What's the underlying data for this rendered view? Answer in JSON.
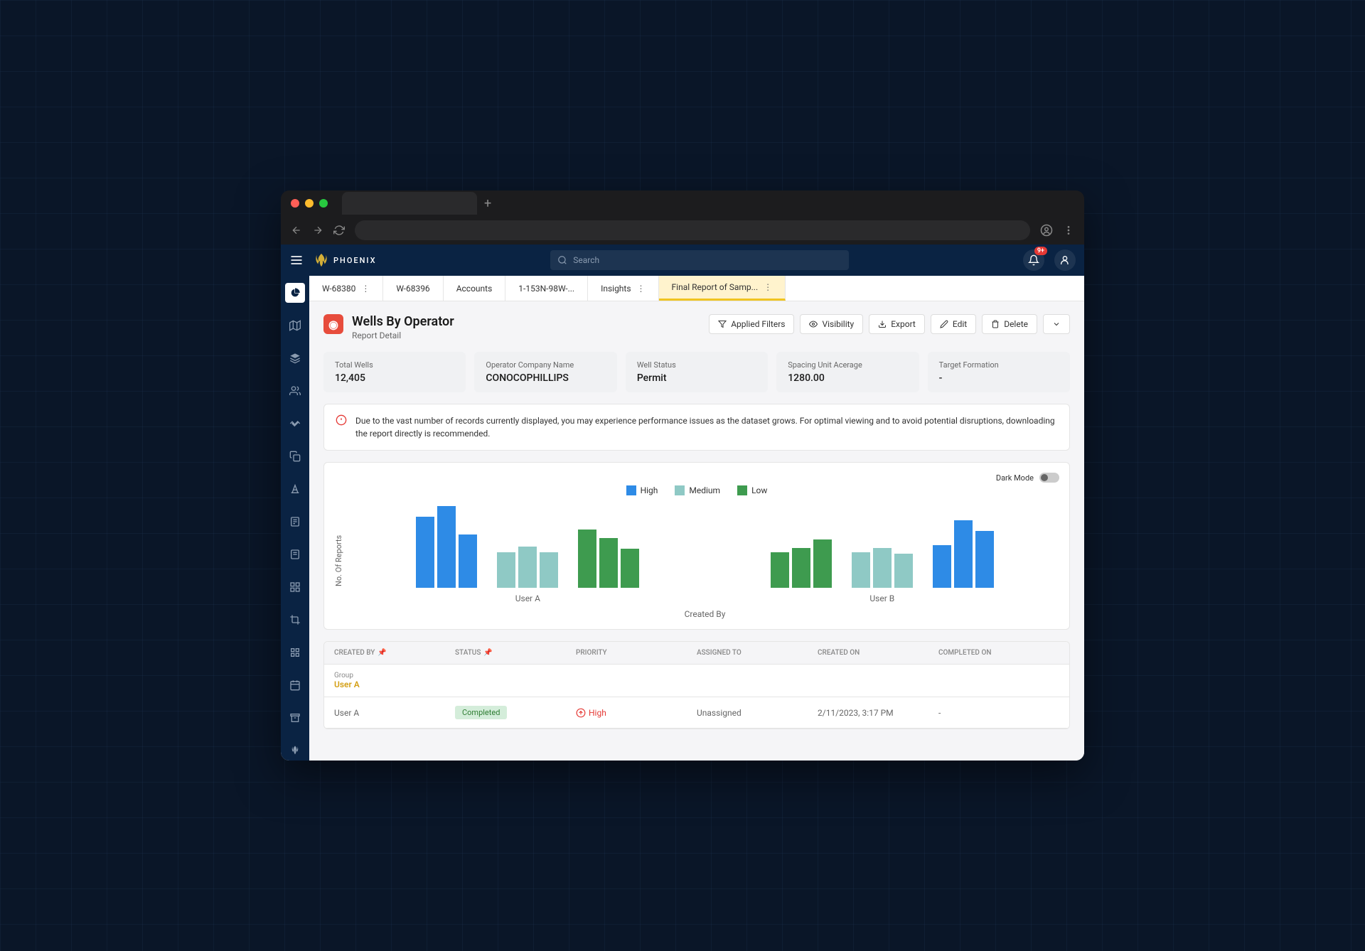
{
  "browser": {
    "new_tab": "+"
  },
  "app": {
    "name": "PHOENIX",
    "search_placeholder": "Search",
    "notif_badge": "9+"
  },
  "tabs": [
    {
      "label": "W-68380",
      "menu": true
    },
    {
      "label": "W-68396"
    },
    {
      "label": "Accounts"
    },
    {
      "label": "1-153N-98W-..."
    },
    {
      "label": "Insights",
      "menu": true
    },
    {
      "label": "Final Report of Samp...",
      "menu": true,
      "active": true
    }
  ],
  "title": {
    "heading": "Wells By Operator",
    "sub": "Report Detail"
  },
  "actions": {
    "filters": "Applied Filters",
    "visibility": "Visibility",
    "export": "Export",
    "edit": "Edit",
    "delete": "Delete"
  },
  "stats": [
    {
      "label": "Total Wells",
      "value": "12,405"
    },
    {
      "label": "Operator Company Name",
      "value": "CONOCOPHILLIPS"
    },
    {
      "label": "Well Status",
      "value": "Permit"
    },
    {
      "label": "Spacing Unit Acerage",
      "value": "1280.00"
    },
    {
      "label": "Target Formation",
      "value": "-"
    }
  ],
  "alert": "Due to the vast number of records currently displayed, you may experience performance issues as the dataset grows. For optimal viewing and to avoid potential disruptions,  downloading the report directly is recommended.",
  "dark_mode_label": "Dark Mode",
  "chart_data": {
    "type": "bar",
    "ylabel": "No. Of Reports",
    "xlabel": "Created By",
    "legend": [
      {
        "name": "High",
        "color": "#2e8be6"
      },
      {
        "name": "Medium",
        "color": "#8fc9c5"
      },
      {
        "name": "Low",
        "color": "#3e9b4f"
      }
    ],
    "groups": [
      {
        "name": "User A",
        "clusters": [
          {
            "values": [
              100,
              115,
              75
            ],
            "colors": [
              "#2e8be6",
              "#2e8be6",
              "#2e8be6"
            ]
          },
          {
            "values": [
              50,
              58,
              50
            ],
            "colors": [
              "#8fc9c5",
              "#8fc9c5",
              "#8fc9c5"
            ]
          },
          {
            "values": [
              82,
              70,
              55
            ],
            "colors": [
              "#3e9b4f",
              "#3e9b4f",
              "#3e9b4f"
            ]
          }
        ]
      },
      {
        "name": "User B",
        "clusters": [
          {
            "values": [
              50,
              56,
              68
            ],
            "colors": [
              "#3e9b4f",
              "#3e9b4f",
              "#3e9b4f"
            ]
          },
          {
            "values": [
              50,
              56,
              48
            ],
            "colors": [
              "#8fc9c5",
              "#8fc9c5",
              "#8fc9c5"
            ]
          },
          {
            "values": [
              60,
              95,
              80
            ],
            "colors": [
              "#2e8be6",
              "#2e8be6",
              "#2e8be6"
            ]
          }
        ]
      }
    ]
  },
  "table": {
    "columns": [
      "CREATED BY",
      "STATUS",
      "PRIORITY",
      "ASSIGNED TO",
      "CREATED ON",
      "COMPLETED ON"
    ],
    "group_label": "Group",
    "group_value": "User A",
    "rows": [
      {
        "created_by": "User A",
        "status": "Completed",
        "priority": "High",
        "assigned_to": "Unassigned",
        "created_on": "2/11/2023, 3:17 PM",
        "completed_on": "-"
      }
    ]
  }
}
